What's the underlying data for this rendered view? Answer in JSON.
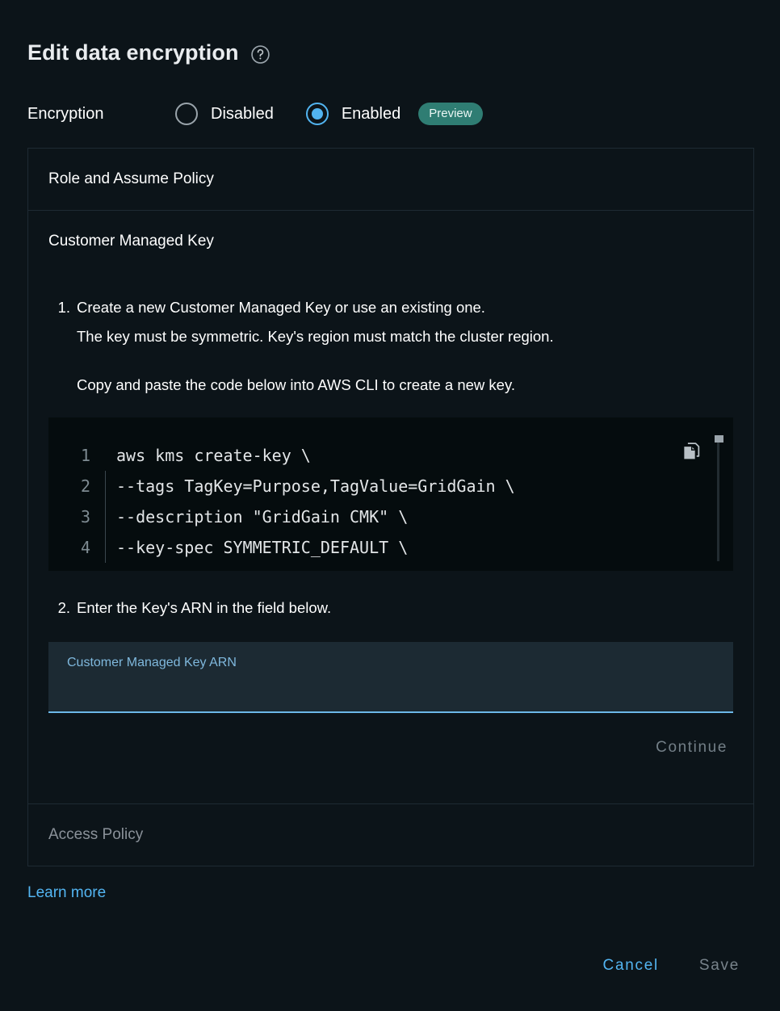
{
  "dialog": {
    "title": "Edit data encryption",
    "help_icon": "help-circle-icon"
  },
  "encryption": {
    "label": "Encryption",
    "options": [
      {
        "label": "Disabled",
        "selected": false
      },
      {
        "label": "Enabled",
        "selected": true
      }
    ],
    "badge": "Preview"
  },
  "panels": [
    {
      "title": "Role and Assume Policy",
      "state": "collapsed"
    },
    {
      "title": "Customer Managed Key",
      "state": "expanded"
    },
    {
      "title": "Access Policy",
      "state": "disabled"
    }
  ],
  "customer_managed_key": {
    "panel_title": "Customer Managed Key",
    "step1": {
      "number": "1.",
      "line1": "Create a new Customer Managed Key or use an existing one.",
      "line2": "The key must be symmetric. Key's region must match the cluster region.",
      "line3": "Copy and paste the code below into AWS CLI to create a new key."
    },
    "code": {
      "copy_icon": "copy-icon",
      "lines": [
        {
          "number": "1",
          "text": "aws kms create-key \\",
          "indented": false
        },
        {
          "number": "2",
          "text": "--tags TagKey=Purpose,TagValue=GridGain \\",
          "indented": true
        },
        {
          "number": "3",
          "text": "--description \"GridGain CMK\" \\",
          "indented": true
        },
        {
          "number": "4",
          "text": "--key-spec SYMMETRIC_DEFAULT \\",
          "indented": true
        }
      ]
    },
    "step2": {
      "number": "2.",
      "line1": "Enter the Key's ARN in the field below."
    },
    "arn_field": {
      "label": "Customer Managed Key ARN",
      "value": "",
      "placeholder": ""
    },
    "continue_label": "Continue"
  },
  "learn_more": "Learn more",
  "footer": {
    "cancel": "Cancel",
    "save": "Save"
  },
  "colors": {
    "background": "#0c1419",
    "accent_blue": "#53b5f2",
    "badge_teal": "#2f7d73",
    "field_background": "#1c2a33",
    "code_background": "#050c0e",
    "disabled_text": "#78838b",
    "border": "#1e2a33"
  }
}
